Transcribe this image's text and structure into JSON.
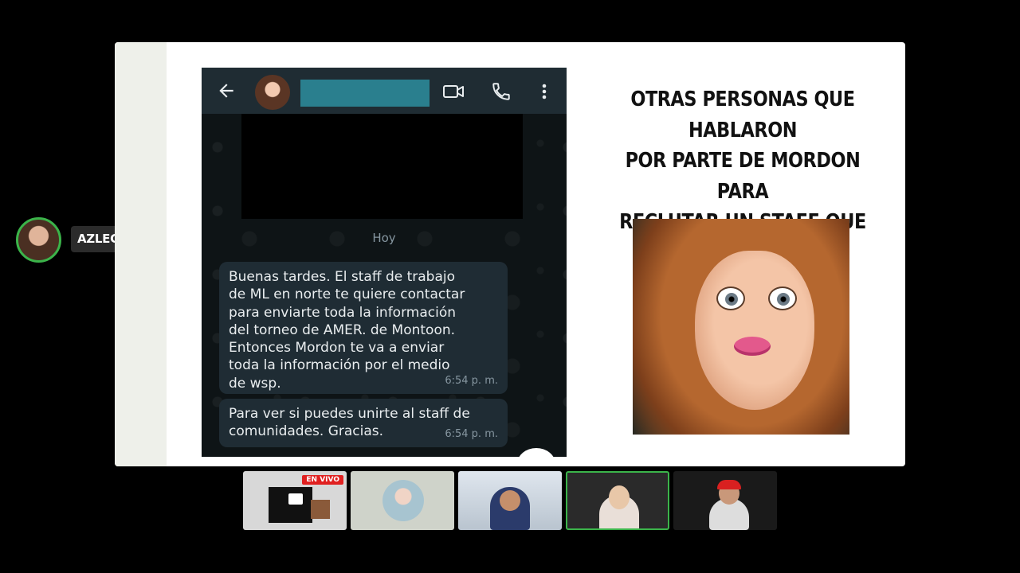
{
  "participant": {
    "name": "AZLEC",
    "badges": [
      "snake-emoji",
      "crown-emoji"
    ],
    "badge_glyphs": "🐍 👑"
  },
  "chat": {
    "date_divider": "Hoy",
    "messages": [
      {
        "text": "Buenas tardes. El staff de trabajo\nde ML en norte te quiere contactar\npara enviarte toda la información\ndel torneo de AMER. de Montoon.\nEntonces Mordon te va a enviar\ntoda la información por el medio\nde wsp.",
        "time": "6:54 p. m."
      },
      {
        "text": "Para ver si puedes unirte al staff de\ncomunidades. Gracias.",
        "time": "6:54 p. m."
      }
    ]
  },
  "slide": {
    "title": "OTRAS PERSONAS QUE HABLARON\nPOR PARTE DE MORDON PARA\nRECLUTAR UN STAFF QUE NO\nSOLICITARON"
  },
  "thumbnails": {
    "live_badge": "EN VIVO",
    "active_speaker_color": "#3bb44a"
  },
  "colors": {
    "accent": "#3bb44a",
    "whatsapp_header": "#1f2c33",
    "bubble": "#1f2c34",
    "live_red": "#e02020"
  }
}
